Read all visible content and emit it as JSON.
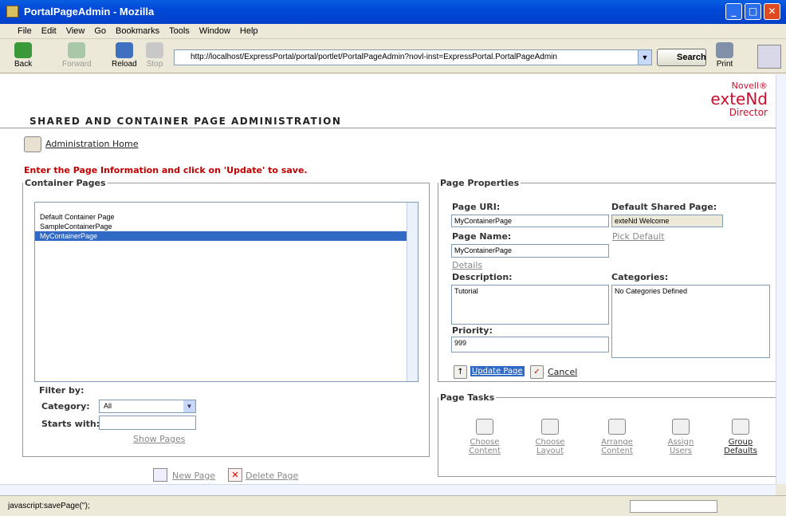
{
  "window": {
    "title": "PortalPageAdmin - Mozilla"
  },
  "menu": [
    "File",
    "Edit",
    "View",
    "Go",
    "Bookmarks",
    "Tools",
    "Window",
    "Help"
  ],
  "nav": {
    "back": "Back",
    "forward": "Forward",
    "reload": "Reload",
    "stop": "Stop",
    "print": "Print",
    "search": "Search"
  },
  "url": "http://localhost/ExpressPortal/portal/portlet/PortalPageAdmin?novl-inst=ExpressPortal.PortalPageAdmin",
  "header": {
    "title": "SHARED AND CONTAINER PAGE ADMINISTRATION",
    "brand_top": "Novell®",
    "brand_mid": "exteNd",
    "brand_bottom": "Director"
  },
  "admin_home": "Administration Home",
  "instruction": "Enter the Page Information and click on 'Update' to save.",
  "container_pages": {
    "legend": "Container Pages",
    "items": [
      "Default Container Page",
      "SampleContainerPage",
      "MyContainerPage"
    ],
    "selected_index": 2,
    "filter_by": "Filter by:",
    "category_label": "Category:",
    "category_value": "All",
    "starts_with_label": "Starts with:",
    "starts_with_value": "",
    "show_pages": "Show Pages"
  },
  "actions": {
    "new_page": "New Page",
    "delete_page": "Delete Page"
  },
  "page_properties": {
    "legend": "Page Properties",
    "uri_label": "Page URI:",
    "uri_value": "MyContainerPage",
    "default_shared_label": "Default Shared Page:",
    "default_shared_value": "exteNd Welcome",
    "pick_default": "Pick Default",
    "name_label": "Page Name:",
    "name_value": "MyContainerPage",
    "details": "Details",
    "description_label": "Description:",
    "description_value": "Tutorial",
    "categories_label": "Categories:",
    "categories_value": "No Categories Defined",
    "priority_label": "Priority:",
    "priority_value": "999",
    "update": "Update Page",
    "cancel": "Cancel"
  },
  "page_tasks": {
    "legend": "Page Tasks",
    "items": [
      {
        "line1": "Choose",
        "line2": "Content",
        "enabled": false
      },
      {
        "line1": "Choose",
        "line2": "Layout",
        "enabled": false
      },
      {
        "line1": "Arrange",
        "line2": "Content",
        "enabled": false
      },
      {
        "line1": "Assign",
        "line2": "Users",
        "enabled": false
      },
      {
        "line1": "Group",
        "line2": "Defaults",
        "enabled": true
      }
    ]
  },
  "status": "javascript:savePage('');"
}
